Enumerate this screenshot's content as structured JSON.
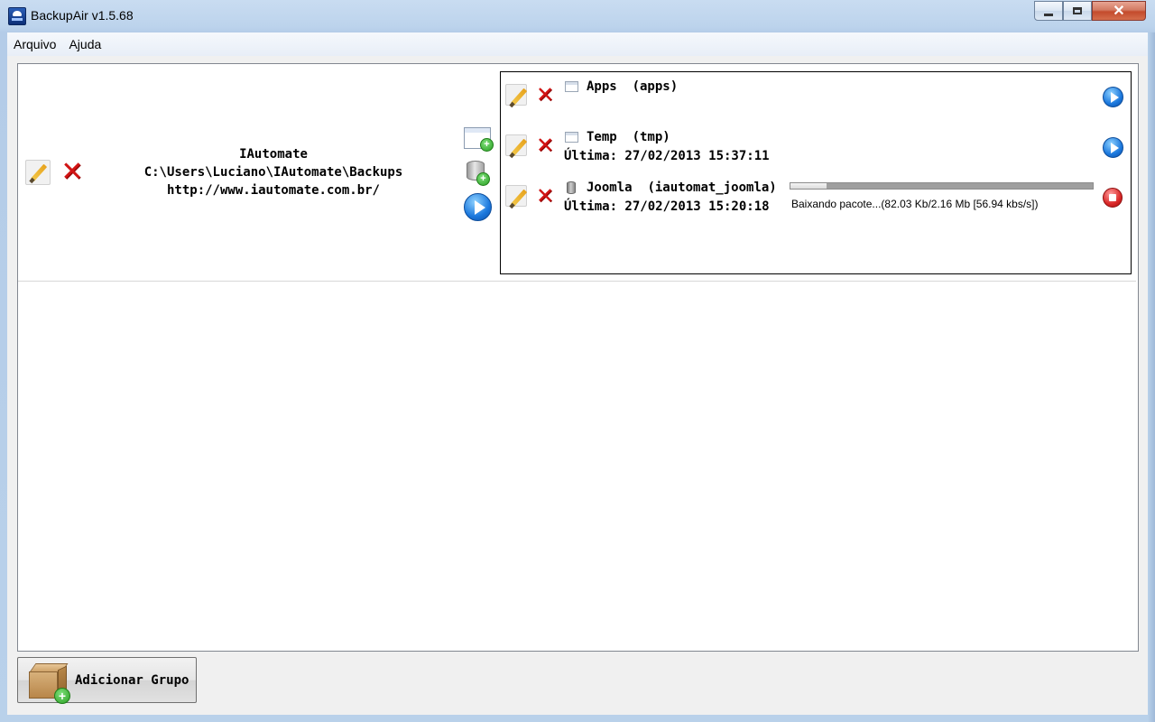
{
  "window": {
    "title": "BackupAir v1.5.68",
    "close_glyph": "✕"
  },
  "menu": {
    "items": [
      "Arquivo",
      "Ajuda"
    ]
  },
  "group": {
    "name": "IAutomate",
    "path": "C:\\Users\\Luciano\\IAutomate\\Backups",
    "url": "http://www.iautomate.com.br/"
  },
  "icons": {
    "edit": "pencil-icon",
    "delete": "x-icon",
    "delete_glyph": "✕",
    "play": "play-icon",
    "stop": "stop-icon",
    "plus_glyph": "+"
  },
  "items": [
    {
      "type": "folder",
      "name": "Apps",
      "alias": "(apps)",
      "last": "",
      "action": "play"
    },
    {
      "type": "folder",
      "name": "Temp",
      "alias": "(tmp)",
      "last": "Última: 27/02/2013 15:37:11",
      "action": "play"
    },
    {
      "type": "database",
      "name": "Joomla",
      "alias": "(iautomat_joomla)",
      "last": "Última: 27/02/2013 15:20:18",
      "action": "stop",
      "progress": {
        "fraction": 0.12,
        "text": "Baixando pacote...(82.03 Kb/2.16 Mb [56.94 kbs/s])"
      }
    }
  ],
  "footer": {
    "add_group_label": "Adicionar Grupo"
  }
}
